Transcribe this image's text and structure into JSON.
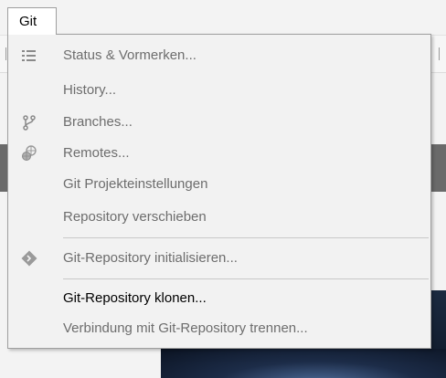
{
  "menubar": {
    "git_label": "Git"
  },
  "menu": {
    "items": [
      {
        "label": "Status & Vormerken...",
        "icon": "list-icon",
        "enabled": false
      },
      {
        "label": "History...",
        "icon": "",
        "enabled": false
      },
      {
        "label": "Branches...",
        "icon": "branch-icon",
        "enabled": false
      },
      {
        "label": "Remotes...",
        "icon": "remote-icon",
        "enabled": false
      },
      {
        "label": "Git Projekteinstellungen",
        "icon": "",
        "enabled": false
      },
      {
        "label": "Repository verschieben",
        "icon": "",
        "enabled": false
      },
      {
        "label": "Git-Repository initialisieren...",
        "icon": "git-diamond-icon",
        "enabled": false
      },
      {
        "label": "Git-Repository klonen...",
        "icon": "",
        "enabled": true
      },
      {
        "label": "Verbindung mit Git-Repository trennen...",
        "icon": "",
        "enabled": false
      }
    ]
  },
  "colors": {
    "enabled_text": "#000000",
    "disabled_text": "#6d6d6d",
    "menu_background": "#f2f2f2",
    "border": "#9e9e9e"
  }
}
